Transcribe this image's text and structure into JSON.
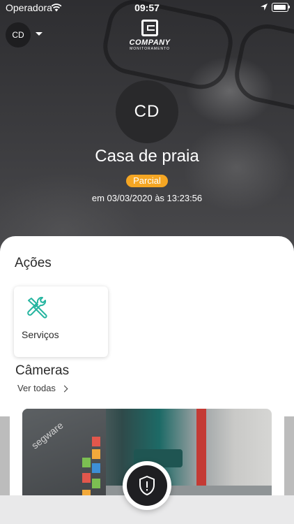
{
  "status_bar": {
    "carrier": "Operadora",
    "time": "09:57"
  },
  "header": {
    "account_initials": "CD",
    "logo_name": "COMPANY",
    "logo_sub": "MONITORAMENTO"
  },
  "site": {
    "initials": "CD",
    "name": "Casa de praia",
    "badge": "Parcial",
    "timestamp": "em 03/03/2020 às 13:23:56"
  },
  "actions": {
    "title": "Ações",
    "items": [
      {
        "label": "Serviços",
        "icon": "tools-icon"
      }
    ]
  },
  "cameras": {
    "title": "Câmeras",
    "see_all": "Ver todas",
    "watermark": "segware"
  },
  "colors": {
    "badge": "#f5a623",
    "accent": "#26b5a0",
    "dark": "#1f1f22"
  }
}
